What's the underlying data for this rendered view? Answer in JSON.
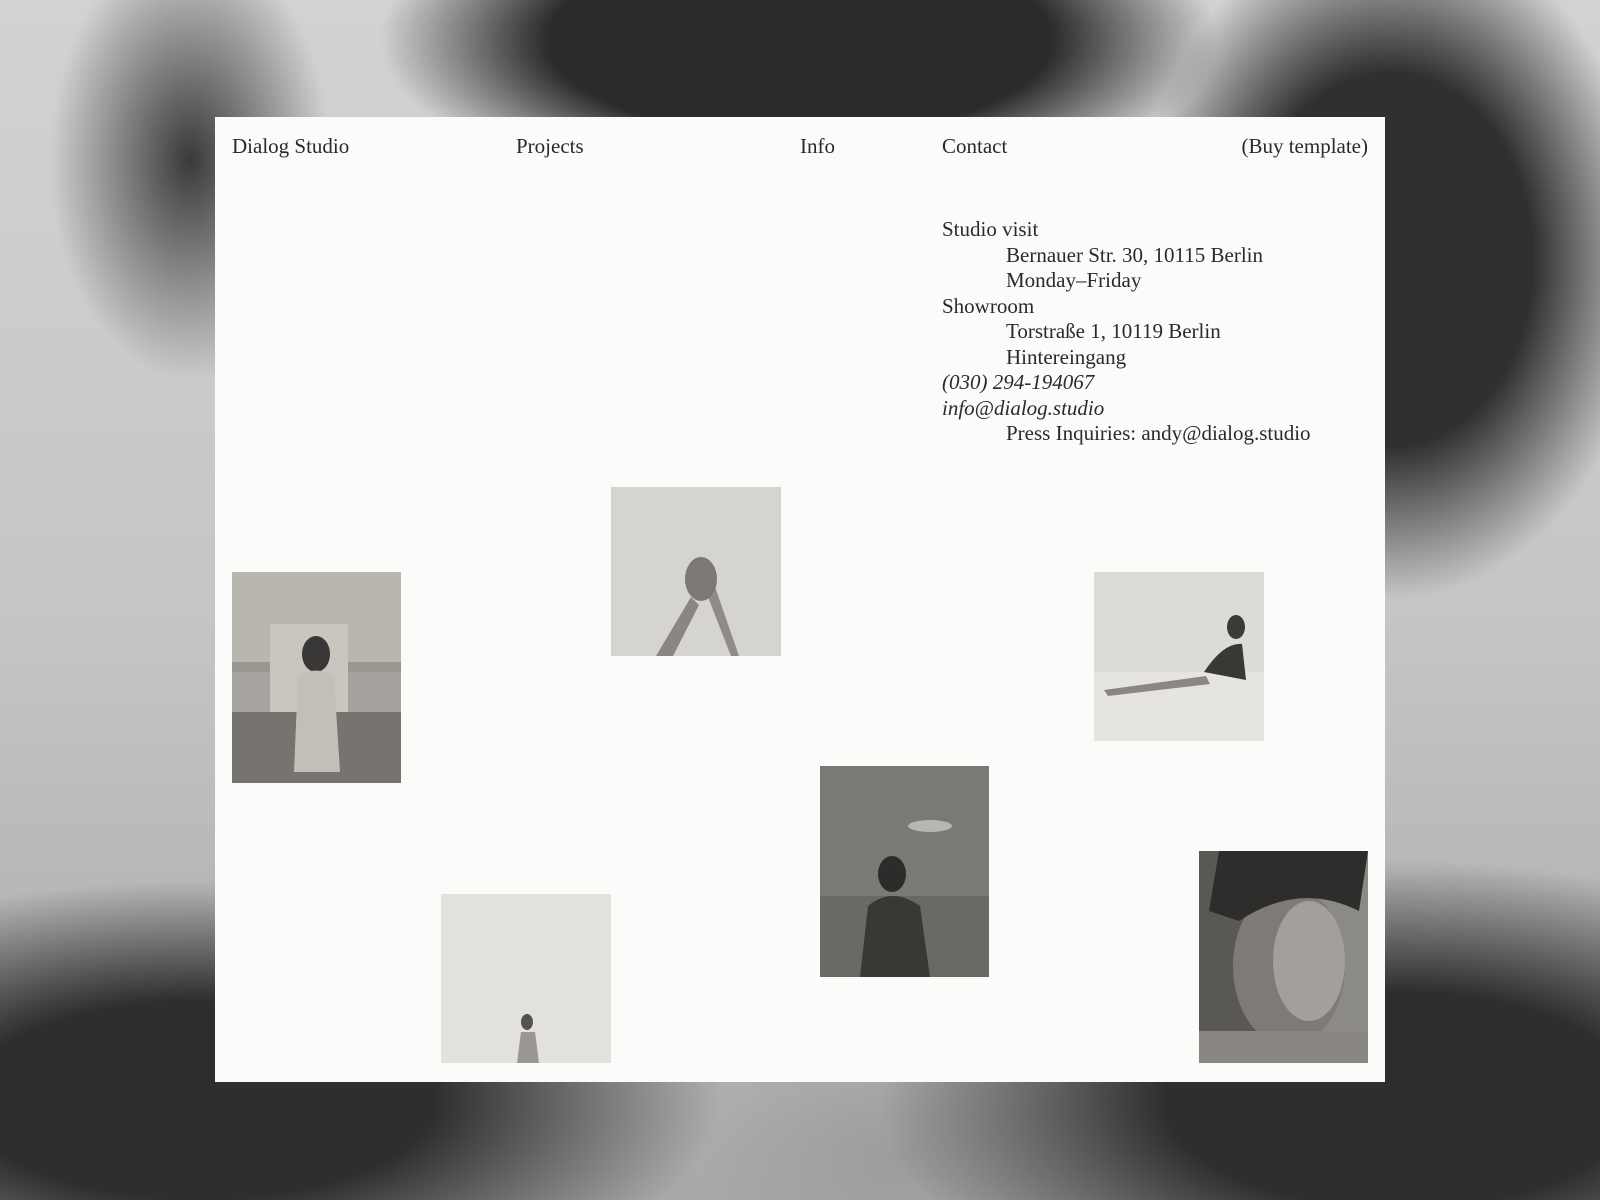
{
  "nav": {
    "brand": "Dialog Studio",
    "projects": "Projects",
    "info": "Info",
    "contact": "Contact",
    "buy": "(Buy template)"
  },
  "contact": {
    "studio_visit_label": "Studio visit",
    "studio_address": "Bernauer Str. 30, 10115 Berlin",
    "studio_hours": "Monday–Friday",
    "showroom_label": "Showroom",
    "showroom_address": "Torstraße 1, 10119 Berlin",
    "showroom_note": "Hintereingang",
    "phone": "(030) 294-194067",
    "email": "info@dialog.studio",
    "press": "Press Inquiries: andy@dialog.studio"
  },
  "photos": [
    {
      "name": "photo-woman-rooftop",
      "tone": "#8f8c86"
    },
    {
      "name": "photo-raised-hands",
      "tone": "#d4d2cd"
    },
    {
      "name": "photo-woman-reclining",
      "tone": "#d8d6d1"
    },
    {
      "name": "photo-woman-desert",
      "tone": "#8a8883"
    },
    {
      "name": "photo-figure-distance",
      "tone": "#e2e0dc"
    },
    {
      "name": "photo-man-portrait",
      "tone": "#6f6d69"
    }
  ],
  "colors": {
    "panel": "#fbfbfa",
    "text": "#2a2a2a",
    "background": "#bdbdbd"
  }
}
